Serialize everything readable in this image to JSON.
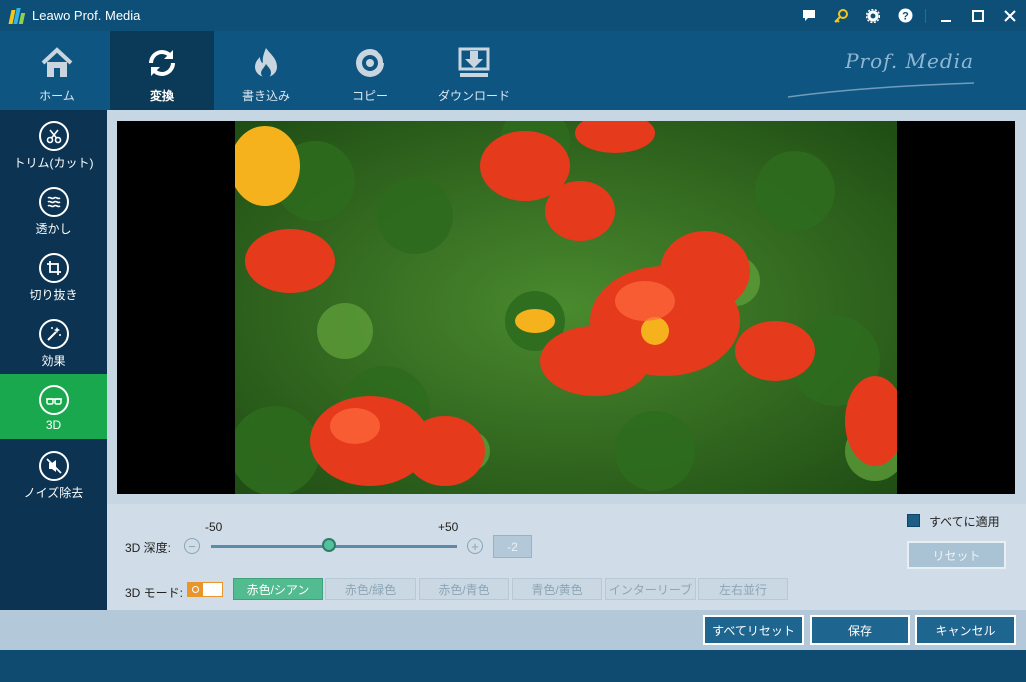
{
  "window": {
    "title": "Leawo Prof. Media"
  },
  "title_icons": [
    "chat-icon",
    "key-icon",
    "gear-icon",
    "help-icon",
    "minimize-icon",
    "maximize-icon",
    "close-icon"
  ],
  "nav": {
    "tabs": [
      {
        "label": "ホーム",
        "icon": "home-icon"
      },
      {
        "label": "変換",
        "icon": "convert-icon",
        "active": true
      },
      {
        "label": "書き込み",
        "icon": "burn-icon"
      },
      {
        "label": "コピー",
        "icon": "copy-disc-icon"
      },
      {
        "label": "ダウンロード",
        "icon": "download-icon"
      }
    ],
    "brand": "Prof. Media"
  },
  "sidebar": {
    "items": [
      {
        "label": "トリム(カット)",
        "icon": "scissors-icon"
      },
      {
        "label": "透かし",
        "icon": "watermark-icon"
      },
      {
        "label": "切り抜き",
        "icon": "crop-icon"
      },
      {
        "label": "効果",
        "icon": "effect-wand-icon"
      },
      {
        "label": "3D",
        "icon": "3d-glasses-icon",
        "active": true
      },
      {
        "label": "ノイズ除去",
        "icon": "denoise-icon"
      }
    ]
  },
  "controls": {
    "depth_label": "3D 深度:",
    "slider_min_label": "-50",
    "slider_max_label": "+50",
    "slider_value": -2,
    "depth_value_display": "-2",
    "mode_label": "3D モード:",
    "modes": [
      {
        "label": "赤色/シアン",
        "selected": true
      },
      {
        "label": "赤色/緑色"
      },
      {
        "label": "赤色/青色"
      },
      {
        "label": "青色/黄色"
      },
      {
        "label": "インターリーブ"
      },
      {
        "label": "左右並行"
      }
    ],
    "apply_all_label": "すべてに適用",
    "reset_label": "リセット"
  },
  "footer": {
    "reset_all_label": "すべてリセット",
    "save_label": "保存",
    "cancel_label": "キャンセル"
  },
  "colors": {
    "accent_green": "#1aa84f",
    "nav_bg": "#0f5582",
    "toggle_orange": "#e8952b"
  }
}
